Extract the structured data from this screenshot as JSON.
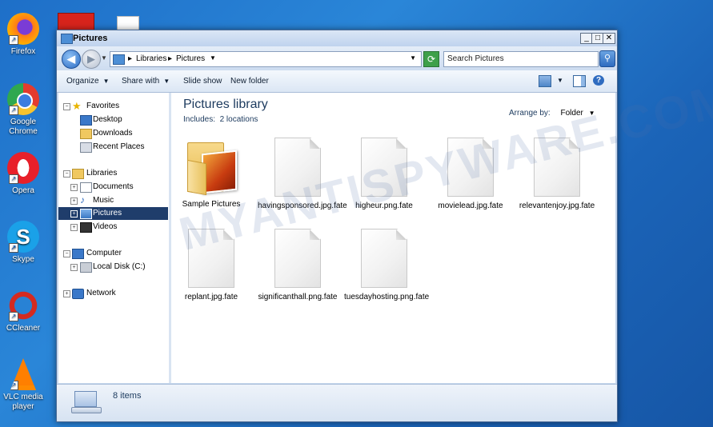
{
  "desktop": {
    "icons": [
      {
        "label": "Firefox",
        "icon": "firefox-icon"
      },
      {
        "label": "Google Chrome",
        "icon": "chrome-icon"
      },
      {
        "label": "Opera",
        "icon": "opera-icon"
      },
      {
        "label": "Skype",
        "icon": "skype-icon"
      },
      {
        "label": "CCleaner",
        "icon": "ccleaner-icon"
      },
      {
        "label": "VLC media player",
        "icon": "vlc-icon"
      }
    ]
  },
  "window": {
    "title": "Pictures",
    "controls": {
      "minimize": "_",
      "maximize": "□",
      "close": "✕"
    }
  },
  "address": {
    "segments": [
      "Libraries",
      "Pictures"
    ],
    "search_placeholder": "Search Pictures"
  },
  "toolbar": {
    "organize": "Organize",
    "share_with": "Share with",
    "slide_show": "Slide show",
    "new_folder": "New folder"
  },
  "navpane": {
    "favorites": "Favorites",
    "desktop": "Desktop",
    "downloads": "Downloads",
    "recent_places": "Recent Places",
    "libraries": "Libraries",
    "documents": "Documents",
    "music": "Music",
    "pictures": "Pictures",
    "videos": "Videos",
    "computer": "Computer",
    "local_disk": "Local Disk (C:)",
    "network": "Network"
  },
  "content": {
    "title": "Pictures library",
    "includes_label": "Includes:",
    "includes_value": "2 locations",
    "arrange_label": "Arrange by:",
    "arrange_value": "Folder",
    "files": [
      {
        "name": "Sample Pictures",
        "type": "folder"
      },
      {
        "name": "havingsponsored.jpg.fate",
        "type": "file"
      },
      {
        "name": "higheur.png.fate",
        "type": "file"
      },
      {
        "name": "movielead.jpg.fate",
        "type": "file"
      },
      {
        "name": "relevantenjoy.jpg.fate",
        "type": "file"
      },
      {
        "name": "replant.jpg.fate",
        "type": "file"
      },
      {
        "name": "significanthall.png.fate",
        "type": "file"
      },
      {
        "name": "tuesdayhosting.png.fate",
        "type": "file"
      }
    ]
  },
  "status": {
    "item_count": "8 items"
  },
  "watermark": "MYANTISPYWARE.COM",
  "colors": {
    "desktop_bg": "#1e6fc8",
    "nav_selected": "#1f3d6b",
    "title_text": "#1c3a5e"
  }
}
